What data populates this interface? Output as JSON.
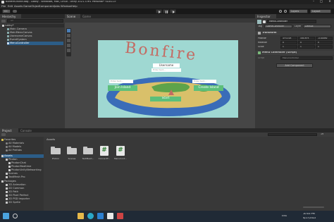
{
  "window": {
    "title": "BonfireOnline.8bg - Lobby - Windows, Mac, Linux - Unity 2021.3.9f1 Personal* <DX11>"
  },
  "menu": [
    "File",
    "Edit",
    "Assets",
    "GameObject",
    "Component",
    "Jobs",
    "Window",
    "Help"
  ],
  "toolbar": {
    "account": "CC",
    "layers": "Layers",
    "layout": "Layout"
  },
  "hierarchy": {
    "tab": "Hierarchy",
    "search_placeholder": "All",
    "items": [
      "Lobby*",
      "Main Camera",
      "MainMenuCanvas",
      "UsernameCanvas",
      "EventSystem",
      "MenuController"
    ]
  },
  "scene": {
    "tabs": [
      "Scene",
      "Game"
    ]
  },
  "game": {
    "title_text": "Bonfire",
    "username_label": "Username",
    "username_placeholder": "Enter text...",
    "room_placeholder_left": "Enter text...",
    "room_placeholder_right": "Enter text...",
    "join_label": "Join Island",
    "create_label": "Create Island",
    "start_label": "Start"
  },
  "inspector": {
    "tab": "Inspector",
    "object_name": "MenuController",
    "tag_label": "Tag",
    "tag_value": "GameController",
    "layer_label": "Layer",
    "layer_value": "Default",
    "transform": {
      "title": "Transform",
      "rows": [
        {
          "label": "Position",
          "x": "474.193",
          "y": "180.873",
          "z": "-0.60082"
        },
        {
          "label": "Rotation",
          "x": "0",
          "y": "0",
          "z": "0"
        },
        {
          "label": "Scale",
          "x": "1",
          "y": "1",
          "z": "1"
        }
      ]
    },
    "component": {
      "title": "Menu Controller (Script)",
      "script_label": "Script",
      "script_value": "MenuController"
    },
    "add_component": "Add Component"
  },
  "project": {
    "tabs": [
      "Project",
      "Console"
    ],
    "favorites_title": "Favorites",
    "favorites": [
      "All Materials",
      "All Models",
      "All Prefabs"
    ],
    "assets_title": "Assets",
    "assets_tree": [
      "Photon",
      "PhotonChat",
      "PhotonRealtime",
      "PhotonUnityNetworking",
      "Scenes",
      "TextMesh Pro"
    ],
    "packages_title": "Packages",
    "packages": [
      "2D Animation",
      "2D Common",
      "2D Path",
      "2D Pixel Perfect",
      "2D PSD Importer",
      "2D Sprite"
    ],
    "breadcrumb": "Assets",
    "assets": [
      {
        "name": "Photon",
        "kind": "folder"
      },
      {
        "name": "Scenes",
        "kind": "folder"
      },
      {
        "name": "TextMesh...",
        "kind": "folder"
      },
      {
        "name": "ConnectT...",
        "kind": "script"
      },
      {
        "name": "MenuCont...",
        "kind": "script"
      }
    ],
    "item_count": "19"
  },
  "taskbar": {
    "time": "10:03 PM",
    "date": "4/27/2022",
    "lang": "ENG",
    "icons": [
      "windows-start",
      "search",
      "explorer",
      "edge",
      "vscode",
      "unity",
      "store"
    ]
  },
  "colors": {
    "game_bg": "#9fd8d2",
    "water": "#3a6cb8",
    "sand": "#d9c06a",
    "grass": "#5ea34a",
    "title_red": "#c46b63",
    "button_green": "#5cbf7a",
    "accent_blue": "#3d6fb8"
  }
}
